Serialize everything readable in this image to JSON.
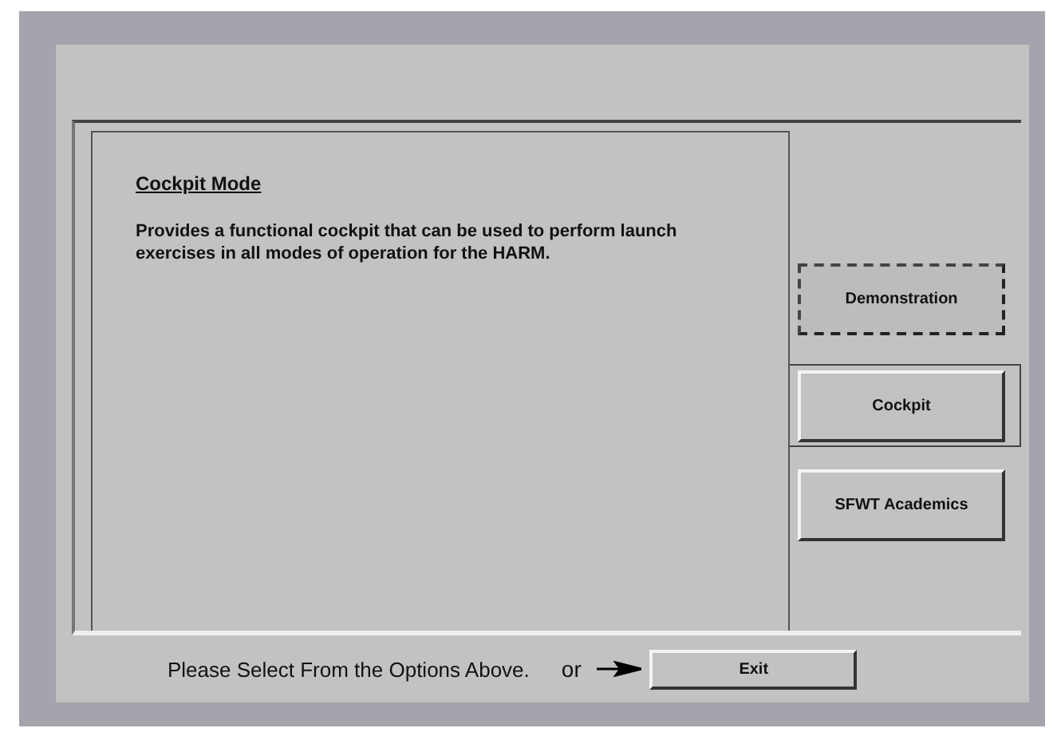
{
  "description": {
    "heading": "Cockpit Mode",
    "text": "Provides a functional cockpit that can be used to perform launch exercises in all modes of operation for the HARM."
  },
  "options": [
    {
      "label": "Demonstration",
      "selected": false,
      "focused": true
    },
    {
      "label": "Cockpit",
      "selected": true,
      "focused": false
    },
    {
      "label": "SFWT Academics",
      "selected": false,
      "focused": false
    }
  ],
  "footer": {
    "prompt": "Please Select From the Options Above.",
    "or": "or",
    "exit": "Exit"
  }
}
